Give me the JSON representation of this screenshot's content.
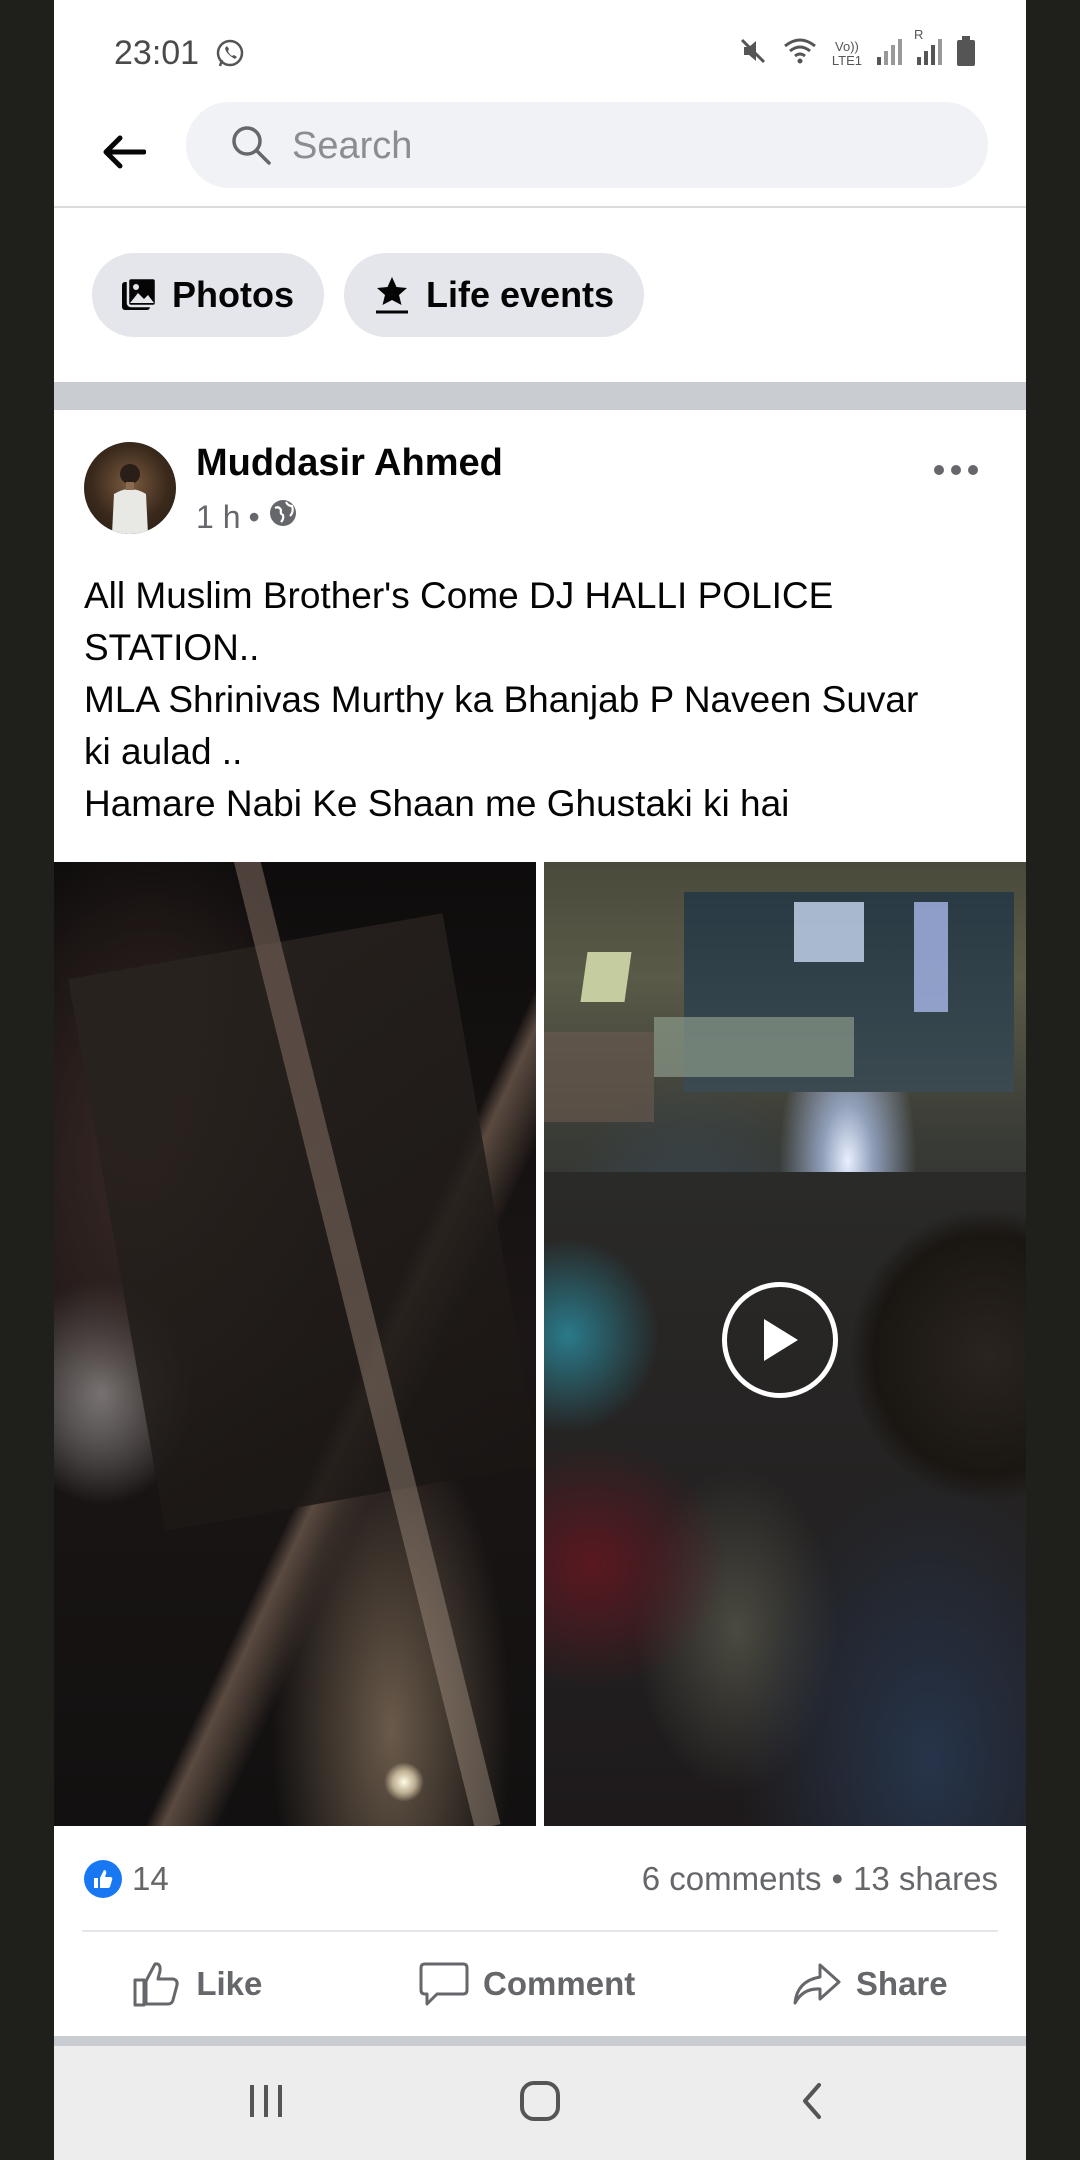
{
  "status_bar": {
    "time": "23:01",
    "network_label_top": "Vo))",
    "network_label_bottom": "LTE1",
    "roaming_label": "R",
    "icons": [
      "whatsapp-icon",
      "mute-icon",
      "wifi-icon",
      "signal-icon",
      "signal-icon",
      "battery-icon"
    ]
  },
  "header": {
    "search_placeholder": "Search"
  },
  "filters": {
    "photos_label": "Photos",
    "life_events_label": "Life events"
  },
  "post": {
    "author": "Muddasir Ahmed",
    "time": "1 h",
    "separator": "•",
    "text_lines": [
      "All Muslim Brother's Come DJ HALLI POLICE",
      "STATION..",
      "MLA Shrinivas Murthy ka Bhanjab P Naveen Suvar",
      "ki aulad ..",
      "Hamare Nabi Ke Shaan me Ghustaki ki hai"
    ],
    "reactions": {
      "like_count": "14",
      "comments": "6 comments",
      "dot": "•",
      "shares": "13 shares"
    },
    "actions": {
      "like": "Like",
      "comment": "Comment",
      "share": "Share"
    }
  },
  "colors": {
    "accent": "#1877f2",
    "text_primary": "#050505",
    "text_secondary": "#65676b",
    "chip_bg": "#e4e6eb",
    "divider": "#c9ccd1"
  }
}
